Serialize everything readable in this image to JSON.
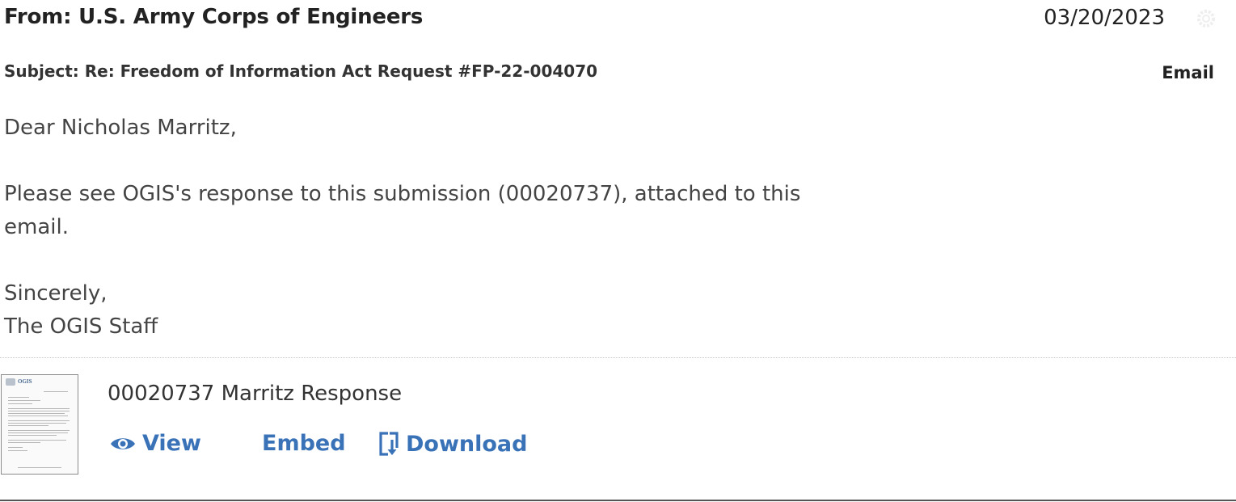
{
  "header": {
    "from": "From: U.S. Army Corps of Engineers",
    "date": "03/20/2023",
    "settings_icon": "gear-icon"
  },
  "subject": {
    "text": "Subject: Re: Freedom of Information Act Request #FP-22-004070",
    "type": "Email"
  },
  "message": {
    "greeting": "Dear Nicholas Marritz,",
    "line1": "Please see OGIS's response to this submission (00020737), attached to this",
    "line2": "email.",
    "closing": "Sincerely,",
    "signature": "The OGIS Staff"
  },
  "attachment": {
    "title": "00020737 Marritz Response",
    "thumbnail_logo": "OGIS",
    "actions": {
      "view": "View",
      "embed": "Embed",
      "download": "Download"
    }
  },
  "colors": {
    "link": "#3a72b8",
    "text": "#333333"
  }
}
